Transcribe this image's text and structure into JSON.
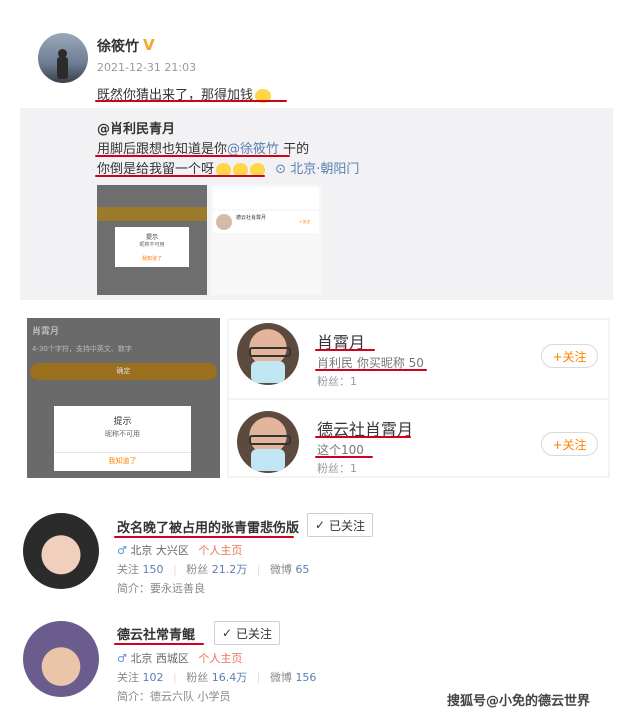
{
  "post": {
    "author": "徐筱竹",
    "timestamp": "2021-12-31 21:03",
    "text": "既然你猜出来了，那得加钱",
    "retweet": {
      "author": "@肖利民青月",
      "line1_pre": "用脚后跟想也知道是你",
      "mention": "@徐筱竹",
      "line1_post": " 干的",
      "line2": "你倒是给我留一个呀",
      "location": "北京·朝阳门",
      "thumb1": {
        "dialog_title": "提示",
        "dialog_text": "昵称不可用",
        "dialog_button": "我知道了"
      },
      "thumb2": {
        "name": "德云社肖霄月",
        "follow": "+关注"
      }
    }
  },
  "rename_screen": {
    "title": "肖霄月",
    "hint": "4-30个字符，支持中英文、数字",
    "confirm_button": "确定",
    "dialog_title": "提示",
    "dialog_text": "昵称不可用",
    "dialog_button": "我知道了"
  },
  "search_results": [
    {
      "name": "肖霄月",
      "sub": "肖利民 你买昵称 50",
      "fans_label": "粉丝：1",
      "follow": "+关注"
    },
    {
      "name": "德云社肖霄月",
      "sub": "这个100",
      "fans_label": "粉丝：1",
      "follow": "+关注"
    }
  ],
  "profiles": [
    {
      "name": "改名晚了被占用的张青雷悲伤版",
      "followed": "已关注",
      "location": "北京 大兴区",
      "homepage": "个人主页",
      "follow_label": "关注",
      "follow_count": "150",
      "fans_label": "粉丝",
      "fans_count": "21.2万",
      "weibo_label": "微博",
      "weibo_count": "65",
      "bio": "简介：要永远善良"
    },
    {
      "name": "德云社常青鲲",
      "followed": "已关注",
      "location": "北京 西城区",
      "homepage": "个人主页",
      "follow_label": "关注",
      "follow_count": "102",
      "fans_label": "粉丝",
      "fans_count": "16.4万",
      "weibo_label": "微博",
      "weibo_count": "156",
      "bio": "简介：德云六队 小学员"
    }
  ],
  "watermark": "搜狐号@小免的德云世界",
  "colors": {
    "accent": "#ff8200",
    "underline": "#d0021b",
    "link": "#eb7350",
    "mention": "#5a7fb0"
  }
}
